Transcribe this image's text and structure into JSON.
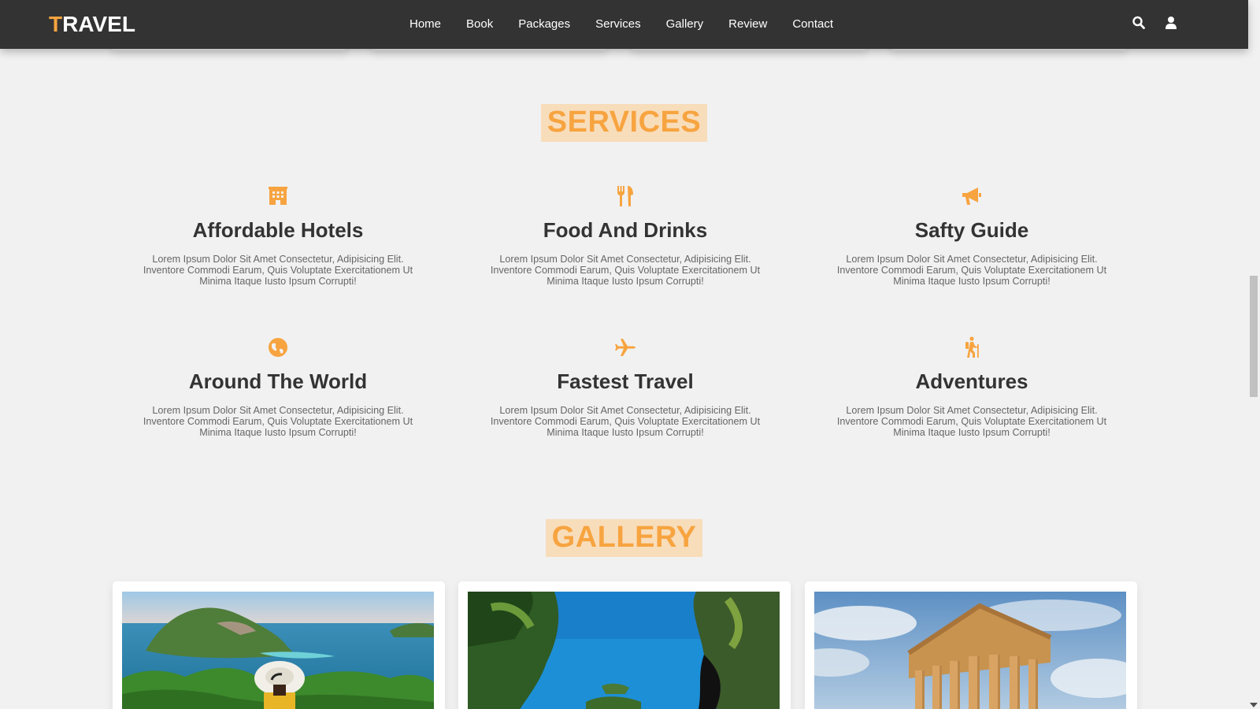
{
  "header": {
    "logo_first": "T",
    "logo_rest": "RAVEL",
    "nav": [
      "Home",
      "Book",
      "Packages",
      "Services",
      "Gallery",
      "Review",
      "Contact"
    ],
    "icons": [
      "search-icon",
      "user-icon"
    ]
  },
  "colors": {
    "accent": "#f7a440",
    "accent_bg": "#f8ddbb",
    "header_bg": "#333333",
    "page_bg": "#f1f1f1"
  },
  "services": {
    "title": "SERVICES",
    "items": [
      {
        "icon": "hotel-icon",
        "title": "Affordable Hotels",
        "text": "Lorem Ipsum Dolor Sit Amet Consectetur, Adipisicing Elit. Inventore Commodi Earum, Quis Voluptate Exercitationem Ut Minima Itaque Iusto Ipsum Corrupti!"
      },
      {
        "icon": "utensils-icon",
        "title": "Food And Drinks",
        "text": "Lorem Ipsum Dolor Sit Amet Consectetur, Adipisicing Elit. Inventore Commodi Earum, Quis Voluptate Exercitationem Ut Minima Itaque Iusto Ipsum Corrupti!"
      },
      {
        "icon": "bullhorn-icon",
        "title": "Safty Guide",
        "text": "Lorem Ipsum Dolor Sit Amet Consectetur, Adipisicing Elit. Inventore Commodi Earum, Quis Voluptate Exercitationem Ut Minima Itaque Iusto Ipsum Corrupti!"
      },
      {
        "icon": "globe-icon",
        "title": "Around The World",
        "text": "Lorem Ipsum Dolor Sit Amet Consectetur, Adipisicing Elit. Inventore Commodi Earum, Quis Voluptate Exercitationem Ut Minima Itaque Iusto Ipsum Corrupti!"
      },
      {
        "icon": "plane-icon",
        "title": "Fastest Travel",
        "text": "Lorem Ipsum Dolor Sit Amet Consectetur, Adipisicing Elit. Inventore Commodi Earum, Quis Voluptate Exercitationem Ut Minima Itaque Iusto Ipsum Corrupti!"
      },
      {
        "icon": "hiking-icon",
        "title": "Adventures",
        "text": "Lorem Ipsum Dolor Sit Amet Consectetur, Adipisicing Elit. Inventore Commodi Earum, Quis Voluptate Exercitationem Ut Minima Itaque Iusto Ipsum Corrupti!"
      }
    ]
  },
  "gallery": {
    "title": "GALLERY",
    "images": [
      "island-lookout-image",
      "tropical-cliffs-image",
      "greek-temple-image"
    ]
  }
}
